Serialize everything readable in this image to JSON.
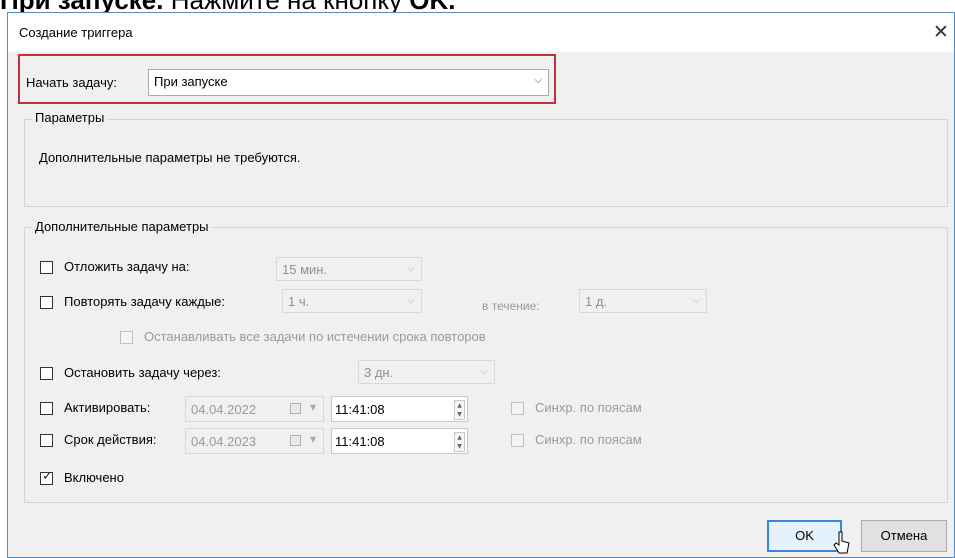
{
  "caption": {
    "bold_part": "При запуске.",
    "rest": " Нажмите на кнопку ",
    "ok_bold": "OK."
  },
  "dialog": {
    "title": "Создание триггера",
    "close_glyph": "✕"
  },
  "start_task": {
    "label": "Начать задачу:",
    "value": "При запуске",
    "arrow": "⌵"
  },
  "parameters": {
    "title": "Параметры",
    "text": "Дополнительные параметры не требуются."
  },
  "advanced": {
    "title": "Дополнительные параметры",
    "delay": {
      "label": "Отложить задачу на:",
      "value": "15 мин.",
      "checked": false
    },
    "repeat": {
      "label": "Повторять задачу каждые:",
      "value": "1 ч.",
      "duration_label": "в течение:",
      "duration_value": "1 д.",
      "checked": false
    },
    "stop_all": {
      "label": "Останавливать все задачи по истечении срока повторов",
      "checked": false
    },
    "stop_after": {
      "label": "Остановить задачу через:",
      "value": "3 дн.",
      "checked": false
    },
    "activate": {
      "label": "Активировать:",
      "date": "04.04.2022",
      "time": "11:41:08",
      "sync_label": "Синхр. по поясам",
      "checked": false
    },
    "expire": {
      "label": "Срок действия:",
      "date": "04.04.2023",
      "time": "11:41:08",
      "sync_label": "Синхр. по поясам",
      "checked": false
    },
    "enabled": {
      "label": "Включено",
      "checked": true
    }
  },
  "buttons": {
    "ok": "OK",
    "cancel": "Отмена"
  },
  "icons": {
    "calendar": "calendar-icon",
    "checkmark": "✓"
  }
}
